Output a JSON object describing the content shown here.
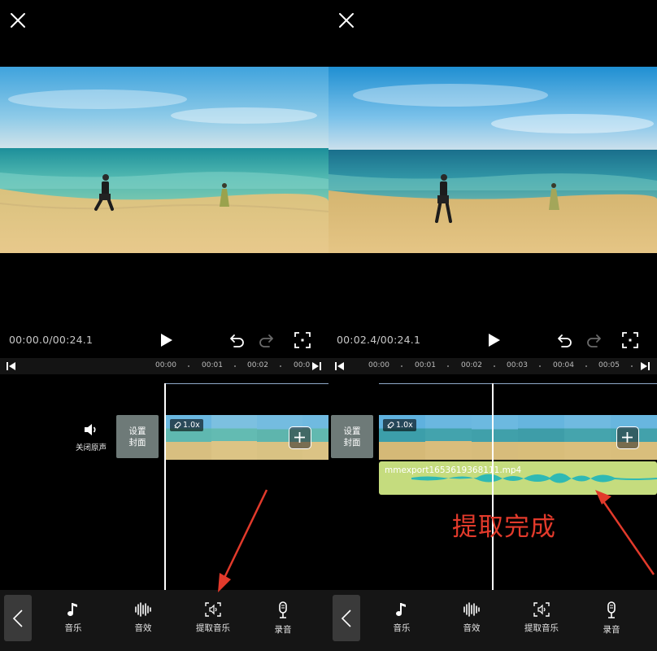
{
  "panels": [
    {
      "timecode": "00:00.0/00:24.1",
      "ruler_ticks": [
        "00:00",
        "00:01",
        "00:02",
        "00:0"
      ],
      "original_sound_label": "关闭原声",
      "cover_label": "设置\n封面",
      "speed_label": "1.0x"
    },
    {
      "timecode": "00:02.4/00:24.1",
      "ruler_ticks": [
        "00:00",
        "00:01",
        "00:02",
        "00:03",
        "00:04",
        "00:05"
      ],
      "cover_label": "设置\n封面",
      "speed_label": "1.0x",
      "audio_clip_name": "mmexport1653619368111.mp4",
      "annotation": "提取完成"
    }
  ],
  "toolbar": {
    "items": [
      {
        "label": "音乐",
        "icon": "music-note-icon"
      },
      {
        "label": "音效",
        "icon": "sound-wave-icon"
      },
      {
        "label": "提取音乐",
        "icon": "extract-music-icon"
      },
      {
        "label": "录音",
        "icon": "microphone-icon"
      }
    ]
  },
  "colors": {
    "audio_track": "#c5dc7e",
    "waveform": "#2fb9b4",
    "annotation": "#e23a2b",
    "cover": "#6e7a78"
  }
}
